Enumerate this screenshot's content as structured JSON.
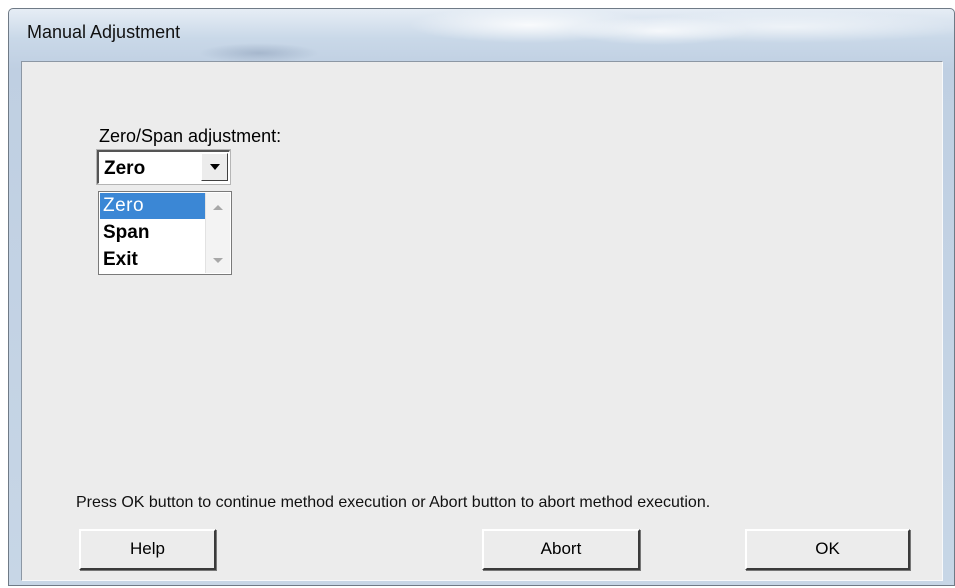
{
  "window": {
    "title": "Manual Adjustment"
  },
  "adjustment": {
    "label": "Zero/Span adjustment:",
    "selected": "Zero",
    "options": [
      "Zero",
      "Span",
      "Exit"
    ],
    "highlighted_index": 0
  },
  "message": "Press OK button to continue method execution or Abort button to abort method execution.",
  "buttons": {
    "help": "Help",
    "abort": "Abort",
    "ok": "OK"
  },
  "icons": {
    "dropdown_arrow": "chevron-down-icon",
    "scroll_up": "scroll-up-icon",
    "scroll_down": "scroll-down-icon"
  },
  "colors": {
    "selection": "#3b87d5",
    "dialog_background": "#ececec",
    "frame": "#c7d6e6"
  }
}
